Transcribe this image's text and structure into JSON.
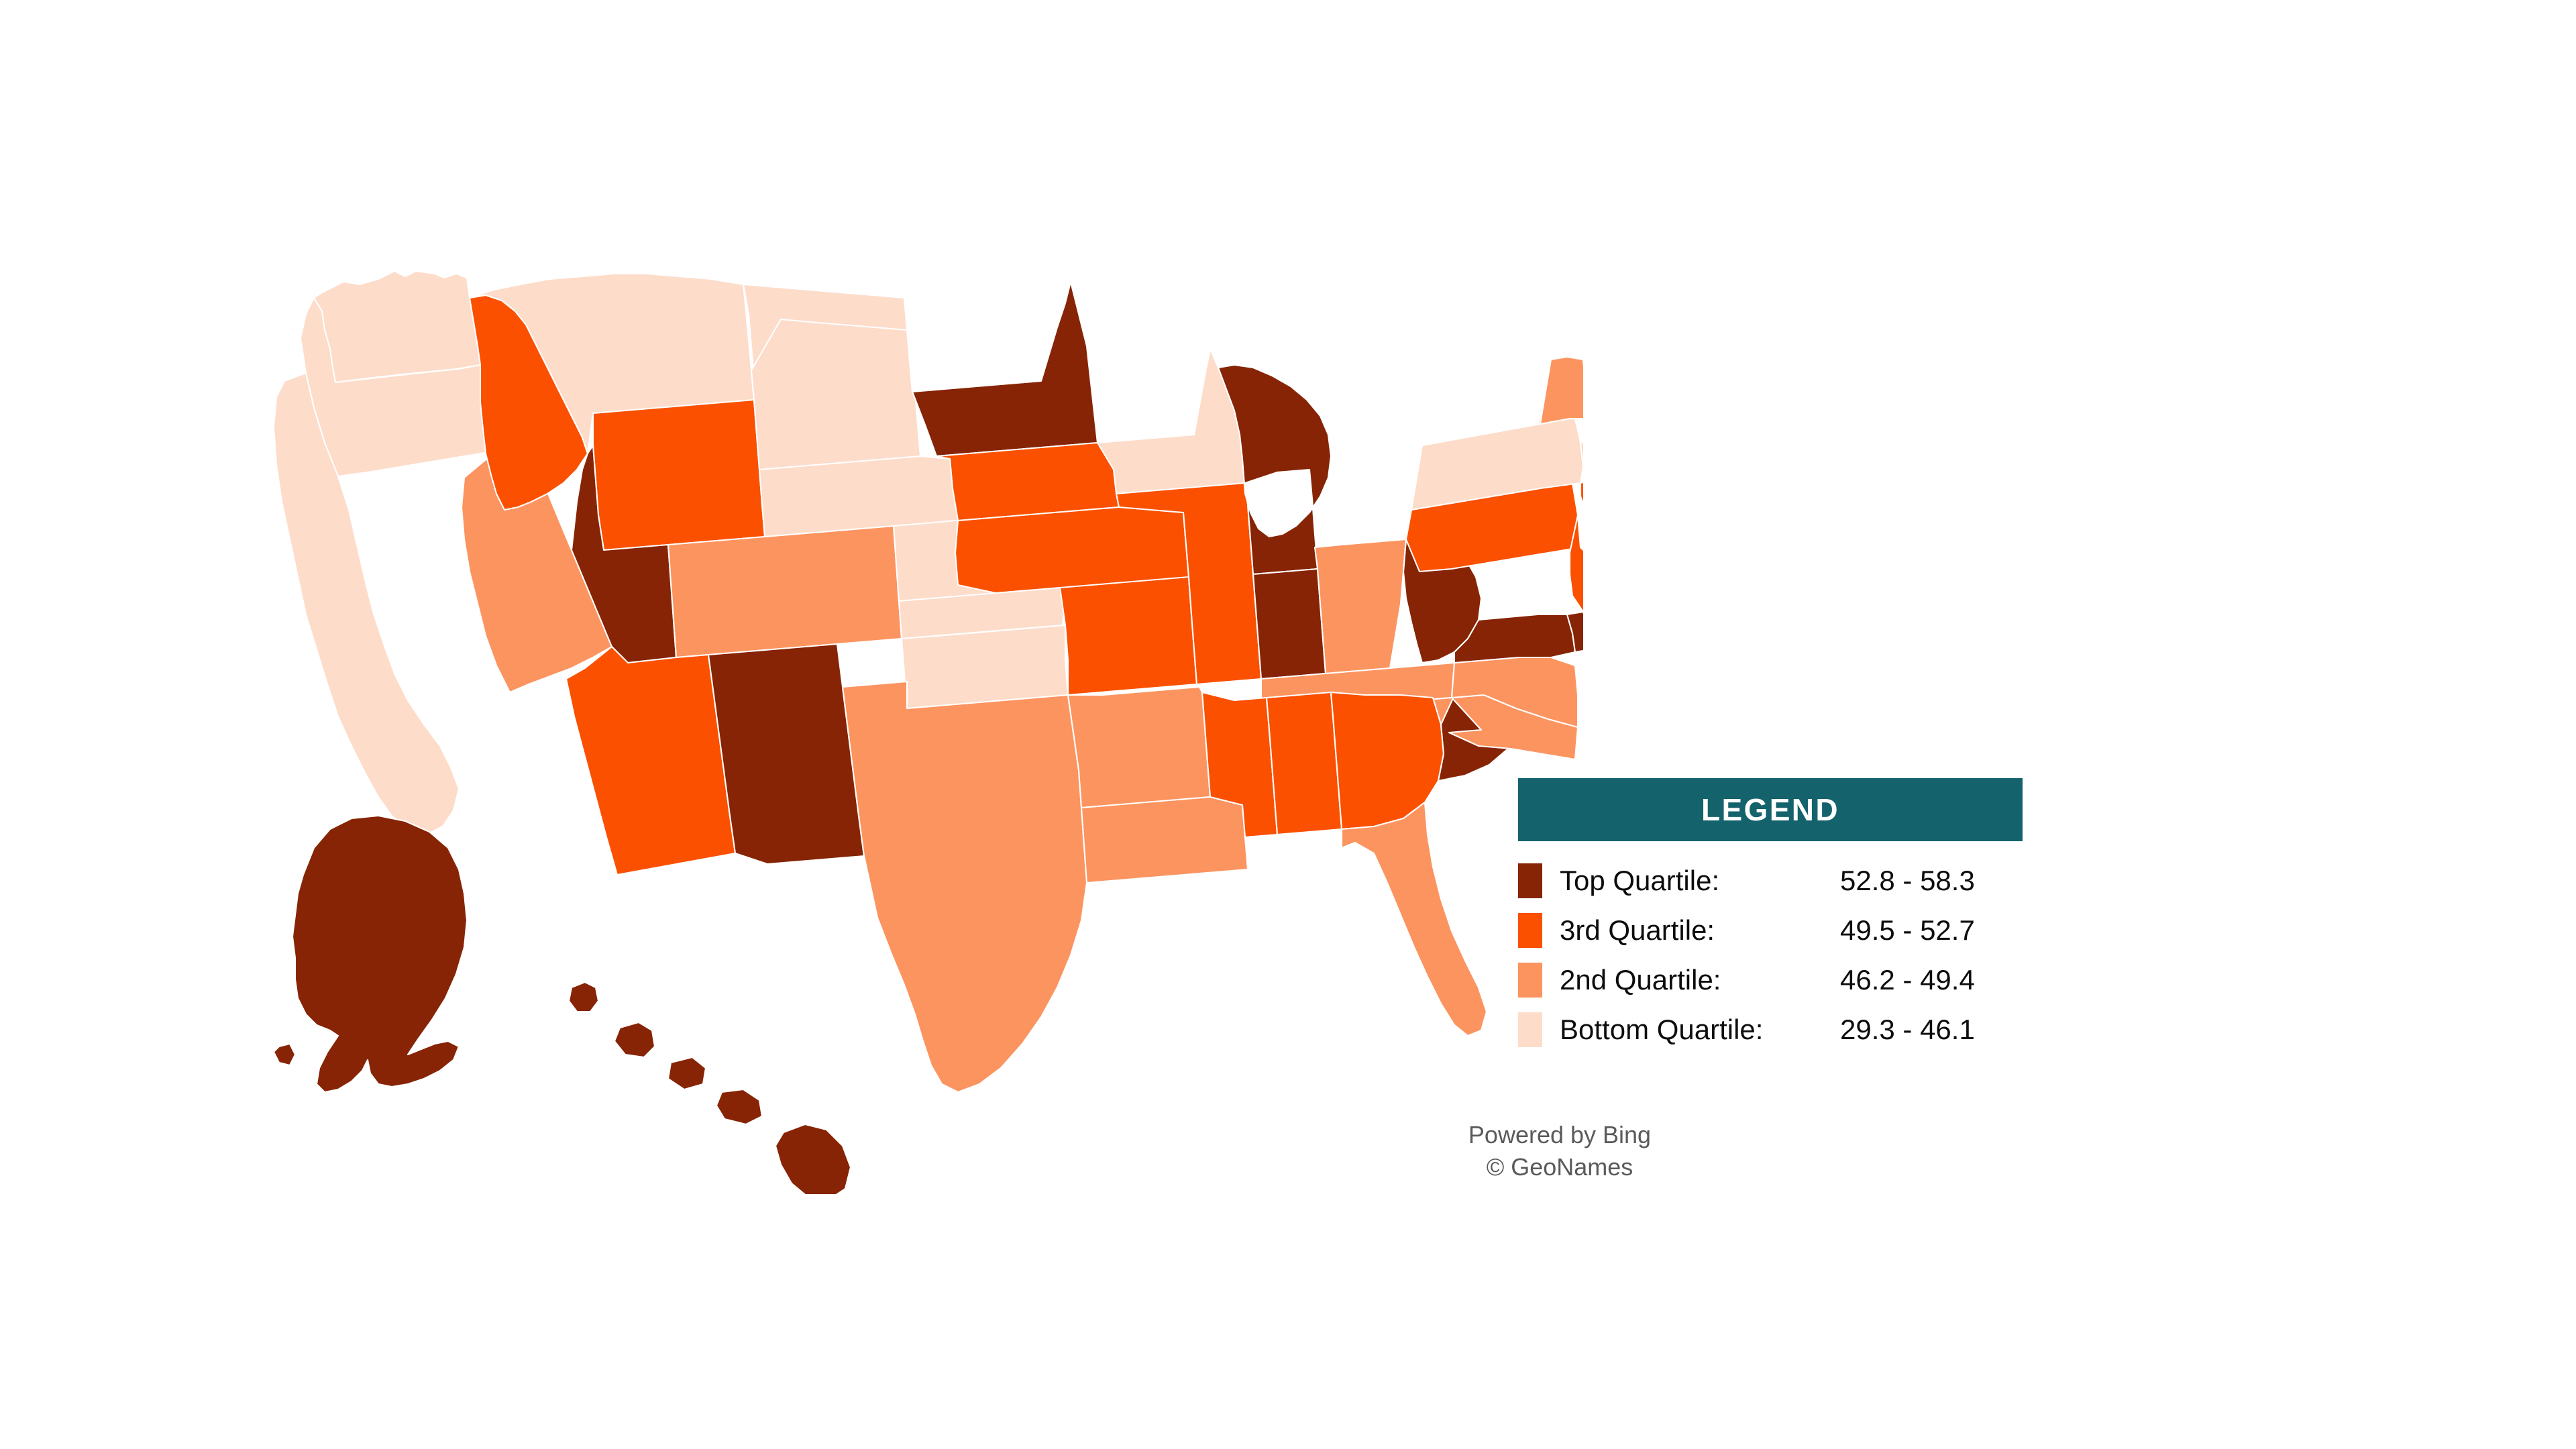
{
  "legend": {
    "title": "LEGEND",
    "header_color": "#14626C",
    "rows": [
      {
        "label": "Top Quartile:",
        "value": "52.8 - 58.3",
        "color": "#862405"
      },
      {
        "label": "3rd Quartile:",
        "value": "49.5 - 52.7",
        "color": "#FA5000"
      },
      {
        "label": "2nd Quartile:",
        "value": "46.2 - 49.4",
        "color": "#FC9460"
      },
      {
        "label": "Bottom Quartile:",
        "value": "29.3 - 46.1",
        "color": "#FDDCCA"
      }
    ]
  },
  "attribution": {
    "line1": "Powered by Bing",
    "line2": "© GeoNames"
  },
  "chart_data": {
    "type": "choropleth",
    "title": "",
    "region": "United States",
    "classification": "quartile",
    "bins": [
      {
        "name": "Top Quartile",
        "range": [
          52.8,
          58.3
        ],
        "color": "#862405"
      },
      {
        "name": "3rd Quartile",
        "range": [
          49.5,
          52.7
        ],
        "color": "#FA5000"
      },
      {
        "name": "2nd Quartile",
        "range": [
          46.2,
          49.4
        ],
        "color": "#FC9460"
      },
      {
        "name": "Bottom Quartile",
        "range": [
          29.3,
          46.1
        ],
        "color": "#FDDCCA"
      }
    ],
    "value_min": 29.3,
    "value_max": 58.3,
    "states": {
      "AL": "3rd Quartile",
      "AK": "Top Quartile",
      "AZ": "3rd Quartile",
      "AR": "2nd Quartile",
      "CA": "Bottom Quartile",
      "CO": "2nd Quartile",
      "CT": "3rd Quartile",
      "DE": "Top Quartile",
      "FL": "2nd Quartile",
      "GA": "3rd Quartile",
      "HI": "Top Quartile",
      "ID": "3rd Quartile",
      "IL": "3rd Quartile",
      "IN": "Top Quartile",
      "IA": "3rd Quartile",
      "KS": "Bottom Quartile",
      "KY": "2nd Quartile",
      "LA": "2nd Quartile",
      "ME": "Top Quartile",
      "MD": "Top Quartile",
      "MA": "Bottom Quartile",
      "MI": "Top Quartile",
      "MN": "Top Quartile",
      "MS": "3rd Quartile",
      "MO": "3rd Quartile",
      "MT": "Bottom Quartile",
      "NE": "Bottom Quartile",
      "NV": "2nd Quartile",
      "NH": "Top Quartile",
      "NJ": "3rd Quartile",
      "NM": "Top Quartile",
      "NY": "Bottom Quartile",
      "NC": "2nd Quartile",
      "ND": "Bottom Quartile",
      "OH": "2nd Quartile",
      "OK": "Bottom Quartile",
      "OR": "Bottom Quartile",
      "PA": "3rd Quartile",
      "RI": "Bottom Quartile",
      "SC": "Top Quartile",
      "SD": "Bottom Quartile",
      "TN": "2nd Quartile",
      "TX": "2nd Quartile",
      "UT": "Top Quartile",
      "VT": "2nd Quartile",
      "VA": "2nd Quartile",
      "WA": "Bottom Quartile",
      "WV": "Top Quartile",
      "WI": "Bottom Quartile",
      "WY": "3rd Quartile"
    }
  }
}
